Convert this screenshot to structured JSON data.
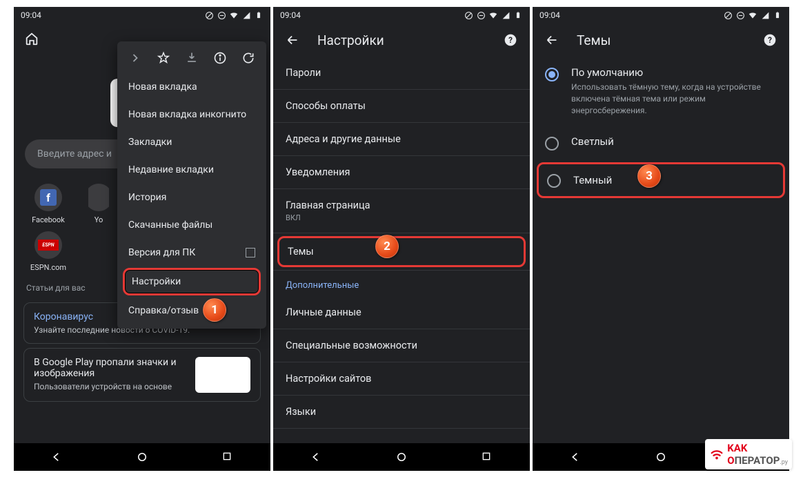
{
  "status": {
    "time": "09:04"
  },
  "panel1": {
    "omnibox_placeholder": "Введите адрес и",
    "tiles": [
      {
        "label": "Facebook",
        "color": "#4267B2",
        "letter": "f"
      },
      {
        "label": "Yo",
        "color": "#ff0000",
        "letter": ""
      },
      {
        "label": "ESPN.com",
        "color": "#cc0000",
        "letter": "ESPN"
      },
      {
        "label": "",
        "color": "#3c3c3f",
        "letter": ""
      }
    ],
    "section_label": "Статьи для вас",
    "card1_title": "Коронавирус",
    "card1_sub": "Узнайте последние новости о COVID-19.",
    "card2_title": "В Google Play пропали значки и изображения",
    "card2_sub": "Пользователи устройств на основе",
    "menu": {
      "items": [
        "Новая вкладка",
        "Новая вкладка инкогнито",
        "Закладки",
        "Недавние вкладки",
        "История",
        "Скачанные файлы",
        "Версия для ПК",
        "Настройки",
        "Справка/отзыв"
      ]
    },
    "badge": "1"
  },
  "panel2": {
    "title": "Настройки",
    "rows_top": [
      "Пароли",
      "Способы оплаты",
      "Адреса и другие данные",
      "Уведомления"
    ],
    "row_home_label": "Главная страница",
    "row_home_sub": "ВКЛ",
    "row_themes": "Темы",
    "section": "Дополнительные",
    "rows_bottom": [
      "Личные данные",
      "Специальные возможности",
      "Настройки сайтов",
      "Языки"
    ],
    "badge": "2"
  },
  "panel3": {
    "title": "Темы",
    "opt_default_label": "По умолчанию",
    "opt_default_sub": "Использовать тёмную тему, когда на устройстве включена тёмная тема или режим энергосбережения.",
    "opt_light": "Светлый",
    "opt_dark": "Темный",
    "badge": "3"
  },
  "watermark": {
    "part1": "K",
    "part2": "AK",
    "part3": "О",
    "part4": "ПЕРАТОР",
    "suffix": ".ру"
  }
}
